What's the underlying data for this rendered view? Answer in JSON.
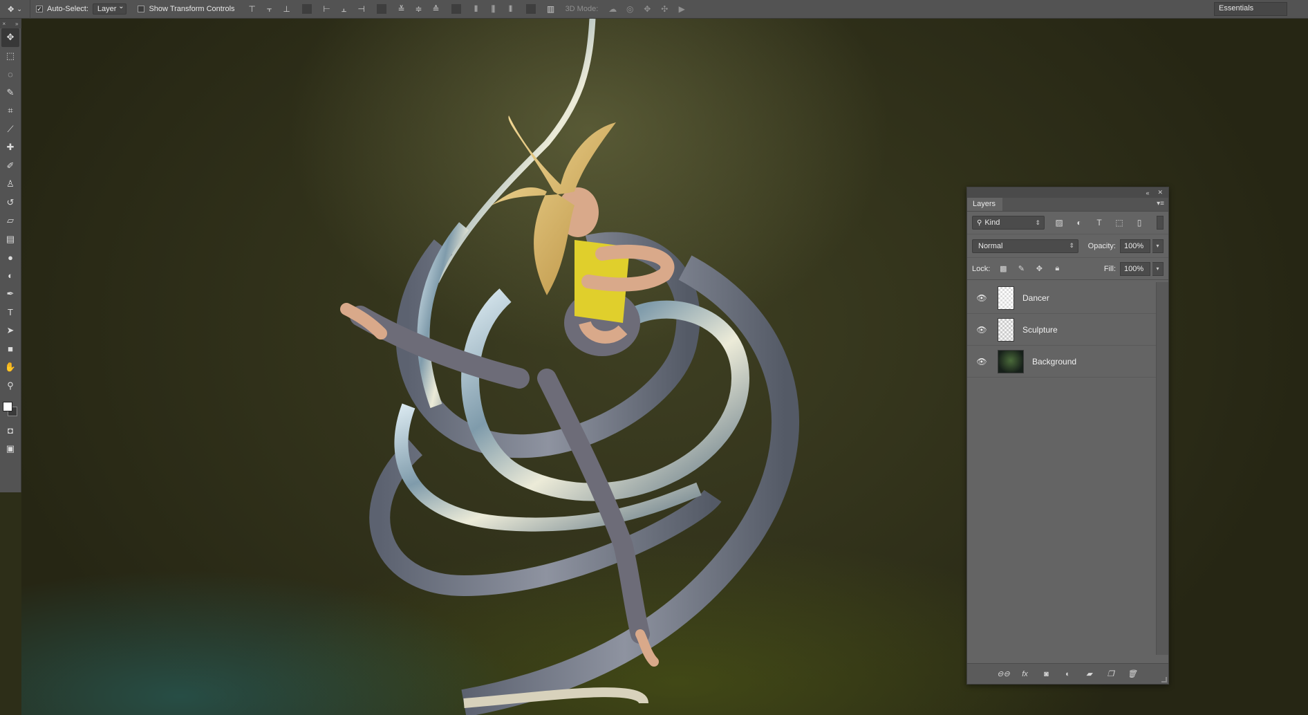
{
  "options_bar": {
    "auto_select_label": "Auto-Select:",
    "auto_select_checked": "✓",
    "auto_select_target": "Layer",
    "show_transform_label": "Show Transform Controls",
    "mode_3d_label": "3D Mode:",
    "workspace": "Essentials"
  },
  "toolbar": {
    "tools": [
      {
        "name": "move-tool",
        "glyph": "✥"
      },
      {
        "name": "marquee-tool",
        "glyph": "⬚"
      },
      {
        "name": "lasso-tool",
        "glyph": "◌"
      },
      {
        "name": "quick-select-tool",
        "glyph": "✎"
      },
      {
        "name": "crop-tool",
        "glyph": "⌗"
      },
      {
        "name": "eyedropper-tool",
        "glyph": "⟋"
      },
      {
        "name": "healing-brush-tool",
        "glyph": "✚"
      },
      {
        "name": "brush-tool",
        "glyph": "✐"
      },
      {
        "name": "clone-stamp-tool",
        "glyph": "♙"
      },
      {
        "name": "history-brush-tool",
        "glyph": "↺"
      },
      {
        "name": "eraser-tool",
        "glyph": "▱"
      },
      {
        "name": "gradient-tool",
        "glyph": "▤"
      },
      {
        "name": "blur-tool",
        "glyph": "●"
      },
      {
        "name": "dodge-tool",
        "glyph": "◐"
      },
      {
        "name": "pen-tool",
        "glyph": "✒"
      },
      {
        "name": "type-tool",
        "glyph": "T"
      },
      {
        "name": "path-select-tool",
        "glyph": "➤"
      },
      {
        "name": "shape-tool",
        "glyph": "■"
      },
      {
        "name": "hand-tool",
        "glyph": "✋"
      },
      {
        "name": "zoom-tool",
        "glyph": "⚲"
      }
    ]
  },
  "layers_panel": {
    "tab_label": "Layers",
    "filter_kind": "Kind",
    "blend_mode": "Normal",
    "opacity_label": "Opacity:",
    "opacity_value": "100%",
    "lock_label": "Lock:",
    "fill_label": "Fill:",
    "fill_value": "100%",
    "layers": [
      {
        "name": "Dancer",
        "visible": true
      },
      {
        "name": "Sculpture",
        "visible": true
      },
      {
        "name": "Background",
        "visible": true
      }
    ],
    "footer_icons": [
      "link-layers-icon",
      "fx-icon",
      "mask-icon",
      "adjustment-icon",
      "folder-icon",
      "new-layer-icon",
      "trash-icon"
    ]
  },
  "colors": {
    "foreground": "#ffffff",
    "background": "#3a3a3a",
    "ui_panel": "#646464",
    "ui_bar": "#535353"
  }
}
